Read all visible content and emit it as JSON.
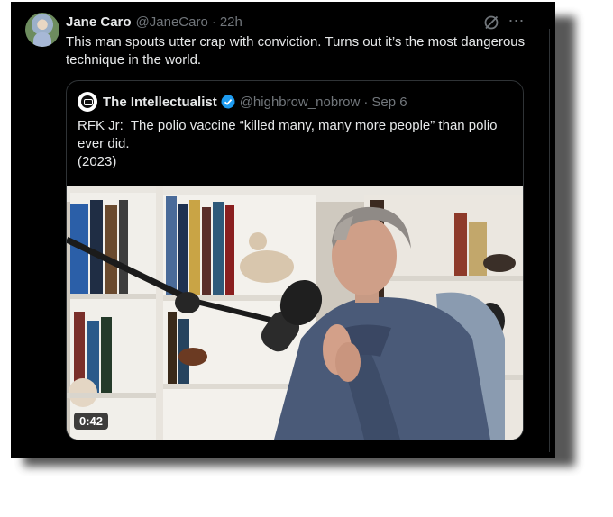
{
  "tweet": {
    "author_name": "Jane Caro",
    "author_handle": "@JaneCaro",
    "separator": "·",
    "time": "22h",
    "text": "This man spouts utter crap with conviction. Turns out it’s the most dangerous technique in the world.",
    "avatar_icon": "user-avatar",
    "grok_icon": "grok-icon",
    "more_icon": "more-options-icon"
  },
  "quoted_tweet": {
    "author_name": "The Intellectualist",
    "verified_icon": "verified-badge-icon",
    "author_handle": "@highbrow_nobrow",
    "separator": "·",
    "date": "Sep 6",
    "text_line1": "RFK Jr:  The polio vaccine “killed many, many more people” than polio ever did.",
    "text_line2": "(2023)",
    "video": {
      "duration": "0:42",
      "thumbnail_description_icon": "video-thumbnail"
    }
  },
  "colors": {
    "background": "#000000",
    "primary_text": "#e7e9ea",
    "secondary_text": "#71767b",
    "border": "#2f3336",
    "verified": "#1d9bf0"
  }
}
